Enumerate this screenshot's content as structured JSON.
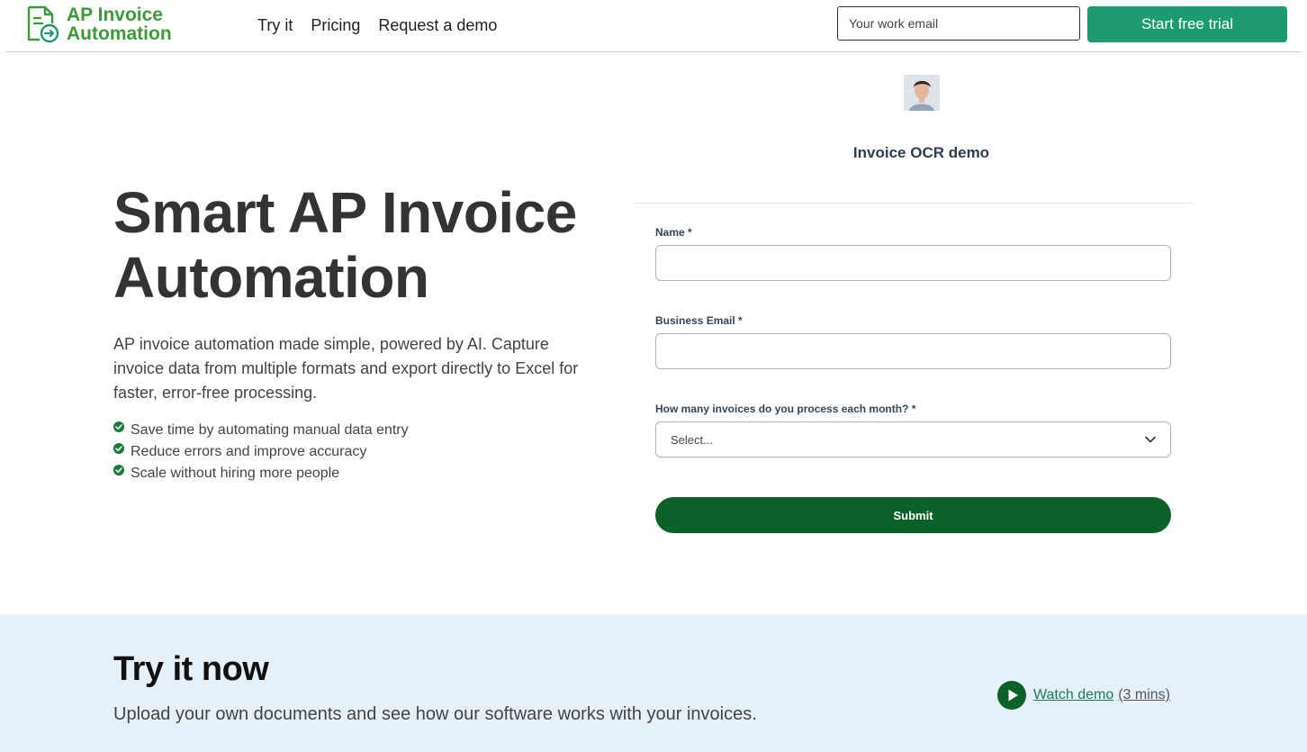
{
  "header": {
    "logo_line1": "AP Invoice",
    "logo_line2": "Automation",
    "nav": [
      "Try it",
      "Pricing",
      "Request a demo"
    ],
    "email_placeholder": "Your work email",
    "trial_label": "Start free trial"
  },
  "hero": {
    "title_line1": "Smart AP Invoice",
    "title_line2": "Automation",
    "description": "AP invoice automation made simple, powered by AI. Capture invoice data from multiple formats and export directly to Excel for faster, error-free processing.",
    "bullets": [
      "Save time by automating manual data entry",
      "Reduce errors and improve accuracy",
      "Scale without hiring more people"
    ]
  },
  "form": {
    "title": "Invoice OCR demo",
    "name_label": "Name *",
    "email_label": "Business Email *",
    "invoices_label": "How many invoices do you process each month? *",
    "select_value": "Select...",
    "submit_label": "Submit"
  },
  "try_section": {
    "title": "Try it now",
    "description": "Upload your own documents and see how our software works with your invoices.",
    "watch_label": "Watch demo",
    "watch_duration": "(3 mins)"
  },
  "colors": {
    "logo_green": "#3d9a3a",
    "trial_button": "#1e9a72",
    "submit_button": "#0c6128",
    "section_bg": "#e5f0f8",
    "check_green": "#1a7a3a"
  }
}
